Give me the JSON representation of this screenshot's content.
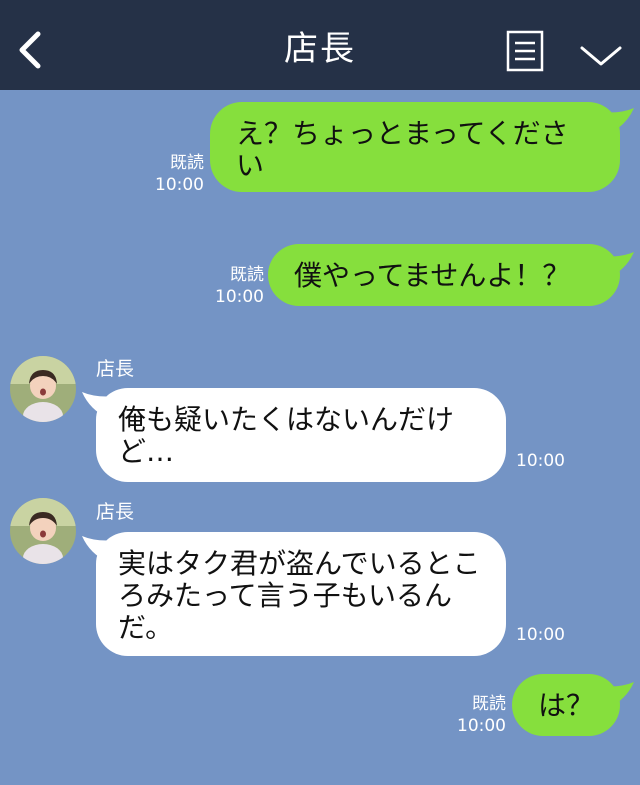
{
  "header": {
    "title": "店長"
  },
  "colors": {
    "header_bg": "#253147",
    "chat_bg": "#7494c5",
    "outgoing_bubble": "#86df3d",
    "incoming_bubble": "#ffffff"
  },
  "messages": [
    {
      "direction": "out",
      "text": "え？ちょっとまってください",
      "read_label": "既読",
      "time": "10:00"
    },
    {
      "direction": "out",
      "text": "僕やってませんよ！？",
      "read_label": "既読",
      "time": "10:00"
    },
    {
      "direction": "in",
      "sender": "店長",
      "text": "俺も疑いたくはないんだけど…",
      "time": "10:00"
    },
    {
      "direction": "in",
      "sender": "店長",
      "text": "実はタク君が盗んでいるところみたって言う子もいるんだ。",
      "time": "10:00"
    },
    {
      "direction": "out",
      "text": "は？",
      "read_label": "既読",
      "time": "10:00"
    }
  ],
  "icons": {
    "back": "chevron-left-icon",
    "menu": "menu-list-icon",
    "collapse": "chevron-down-icon"
  }
}
